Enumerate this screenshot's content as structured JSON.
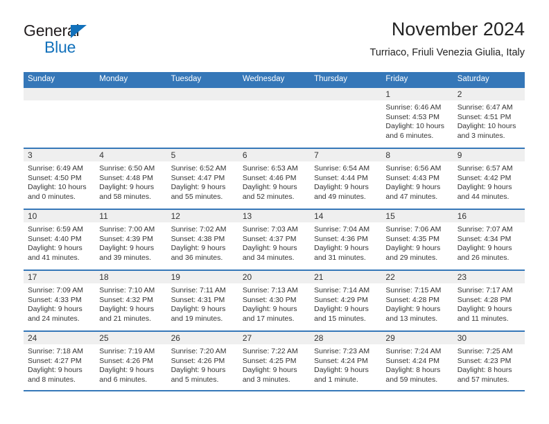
{
  "brand": {
    "line1": "General",
    "line2": "Blue",
    "mark": "triangle-flag-icon",
    "accent": "#1271bb"
  },
  "header": {
    "title": "November 2024",
    "subtitle": "Turriaco, Friuli Venezia Giulia, Italy"
  },
  "theme": {
    "header_blue": "#3577b8",
    "day_strip_gray": "#efefef",
    "text": "#333333"
  },
  "weekdays": [
    "Sunday",
    "Monday",
    "Tuesday",
    "Wednesday",
    "Thursday",
    "Friday",
    "Saturday"
  ],
  "weeks": [
    [
      {
        "day": "",
        "sunrise": "",
        "sunset": "",
        "daylight": "",
        "daylight2": ""
      },
      {
        "day": "",
        "sunrise": "",
        "sunset": "",
        "daylight": "",
        "daylight2": ""
      },
      {
        "day": "",
        "sunrise": "",
        "sunset": "",
        "daylight": "",
        "daylight2": ""
      },
      {
        "day": "",
        "sunrise": "",
        "sunset": "",
        "daylight": "",
        "daylight2": ""
      },
      {
        "day": "",
        "sunrise": "",
        "sunset": "",
        "daylight": "",
        "daylight2": ""
      },
      {
        "day": "1",
        "sunrise": "Sunrise: 6:46 AM",
        "sunset": "Sunset: 4:53 PM",
        "daylight": "Daylight: 10 hours",
        "daylight2": "and 6 minutes."
      },
      {
        "day": "2",
        "sunrise": "Sunrise: 6:47 AM",
        "sunset": "Sunset: 4:51 PM",
        "daylight": "Daylight: 10 hours",
        "daylight2": "and 3 minutes."
      }
    ],
    [
      {
        "day": "3",
        "sunrise": "Sunrise: 6:49 AM",
        "sunset": "Sunset: 4:50 PM",
        "daylight": "Daylight: 10 hours",
        "daylight2": "and 0 minutes."
      },
      {
        "day": "4",
        "sunrise": "Sunrise: 6:50 AM",
        "sunset": "Sunset: 4:48 PM",
        "daylight": "Daylight: 9 hours",
        "daylight2": "and 58 minutes."
      },
      {
        "day": "5",
        "sunrise": "Sunrise: 6:52 AM",
        "sunset": "Sunset: 4:47 PM",
        "daylight": "Daylight: 9 hours",
        "daylight2": "and 55 minutes."
      },
      {
        "day": "6",
        "sunrise": "Sunrise: 6:53 AM",
        "sunset": "Sunset: 4:46 PM",
        "daylight": "Daylight: 9 hours",
        "daylight2": "and 52 minutes."
      },
      {
        "day": "7",
        "sunrise": "Sunrise: 6:54 AM",
        "sunset": "Sunset: 4:44 PM",
        "daylight": "Daylight: 9 hours",
        "daylight2": "and 49 minutes."
      },
      {
        "day": "8",
        "sunrise": "Sunrise: 6:56 AM",
        "sunset": "Sunset: 4:43 PM",
        "daylight": "Daylight: 9 hours",
        "daylight2": "and 47 minutes."
      },
      {
        "day": "9",
        "sunrise": "Sunrise: 6:57 AM",
        "sunset": "Sunset: 4:42 PM",
        "daylight": "Daylight: 9 hours",
        "daylight2": "and 44 minutes."
      }
    ],
    [
      {
        "day": "10",
        "sunrise": "Sunrise: 6:59 AM",
        "sunset": "Sunset: 4:40 PM",
        "daylight": "Daylight: 9 hours",
        "daylight2": "and 41 minutes."
      },
      {
        "day": "11",
        "sunrise": "Sunrise: 7:00 AM",
        "sunset": "Sunset: 4:39 PM",
        "daylight": "Daylight: 9 hours",
        "daylight2": "and 39 minutes."
      },
      {
        "day": "12",
        "sunrise": "Sunrise: 7:02 AM",
        "sunset": "Sunset: 4:38 PM",
        "daylight": "Daylight: 9 hours",
        "daylight2": "and 36 minutes."
      },
      {
        "day": "13",
        "sunrise": "Sunrise: 7:03 AM",
        "sunset": "Sunset: 4:37 PM",
        "daylight": "Daylight: 9 hours",
        "daylight2": "and 34 minutes."
      },
      {
        "day": "14",
        "sunrise": "Sunrise: 7:04 AM",
        "sunset": "Sunset: 4:36 PM",
        "daylight": "Daylight: 9 hours",
        "daylight2": "and 31 minutes."
      },
      {
        "day": "15",
        "sunrise": "Sunrise: 7:06 AM",
        "sunset": "Sunset: 4:35 PM",
        "daylight": "Daylight: 9 hours",
        "daylight2": "and 29 minutes."
      },
      {
        "day": "16",
        "sunrise": "Sunrise: 7:07 AM",
        "sunset": "Sunset: 4:34 PM",
        "daylight": "Daylight: 9 hours",
        "daylight2": "and 26 minutes."
      }
    ],
    [
      {
        "day": "17",
        "sunrise": "Sunrise: 7:09 AM",
        "sunset": "Sunset: 4:33 PM",
        "daylight": "Daylight: 9 hours",
        "daylight2": "and 24 minutes."
      },
      {
        "day": "18",
        "sunrise": "Sunrise: 7:10 AM",
        "sunset": "Sunset: 4:32 PM",
        "daylight": "Daylight: 9 hours",
        "daylight2": "and 21 minutes."
      },
      {
        "day": "19",
        "sunrise": "Sunrise: 7:11 AM",
        "sunset": "Sunset: 4:31 PM",
        "daylight": "Daylight: 9 hours",
        "daylight2": "and 19 minutes."
      },
      {
        "day": "20",
        "sunrise": "Sunrise: 7:13 AM",
        "sunset": "Sunset: 4:30 PM",
        "daylight": "Daylight: 9 hours",
        "daylight2": "and 17 minutes."
      },
      {
        "day": "21",
        "sunrise": "Sunrise: 7:14 AM",
        "sunset": "Sunset: 4:29 PM",
        "daylight": "Daylight: 9 hours",
        "daylight2": "and 15 minutes."
      },
      {
        "day": "22",
        "sunrise": "Sunrise: 7:15 AM",
        "sunset": "Sunset: 4:28 PM",
        "daylight": "Daylight: 9 hours",
        "daylight2": "and 13 minutes."
      },
      {
        "day": "23",
        "sunrise": "Sunrise: 7:17 AM",
        "sunset": "Sunset: 4:28 PM",
        "daylight": "Daylight: 9 hours",
        "daylight2": "and 11 minutes."
      }
    ],
    [
      {
        "day": "24",
        "sunrise": "Sunrise: 7:18 AM",
        "sunset": "Sunset: 4:27 PM",
        "daylight": "Daylight: 9 hours",
        "daylight2": "and 8 minutes."
      },
      {
        "day": "25",
        "sunrise": "Sunrise: 7:19 AM",
        "sunset": "Sunset: 4:26 PM",
        "daylight": "Daylight: 9 hours",
        "daylight2": "and 6 minutes."
      },
      {
        "day": "26",
        "sunrise": "Sunrise: 7:20 AM",
        "sunset": "Sunset: 4:26 PM",
        "daylight": "Daylight: 9 hours",
        "daylight2": "and 5 minutes."
      },
      {
        "day": "27",
        "sunrise": "Sunrise: 7:22 AM",
        "sunset": "Sunset: 4:25 PM",
        "daylight": "Daylight: 9 hours",
        "daylight2": "and 3 minutes."
      },
      {
        "day": "28",
        "sunrise": "Sunrise: 7:23 AM",
        "sunset": "Sunset: 4:24 PM",
        "daylight": "Daylight: 9 hours",
        "daylight2": "and 1 minute."
      },
      {
        "day": "29",
        "sunrise": "Sunrise: 7:24 AM",
        "sunset": "Sunset: 4:24 PM",
        "daylight": "Daylight: 8 hours",
        "daylight2": "and 59 minutes."
      },
      {
        "day": "30",
        "sunrise": "Sunrise: 7:25 AM",
        "sunset": "Sunset: 4:23 PM",
        "daylight": "Daylight: 8 hours",
        "daylight2": "and 57 minutes."
      }
    ]
  ]
}
